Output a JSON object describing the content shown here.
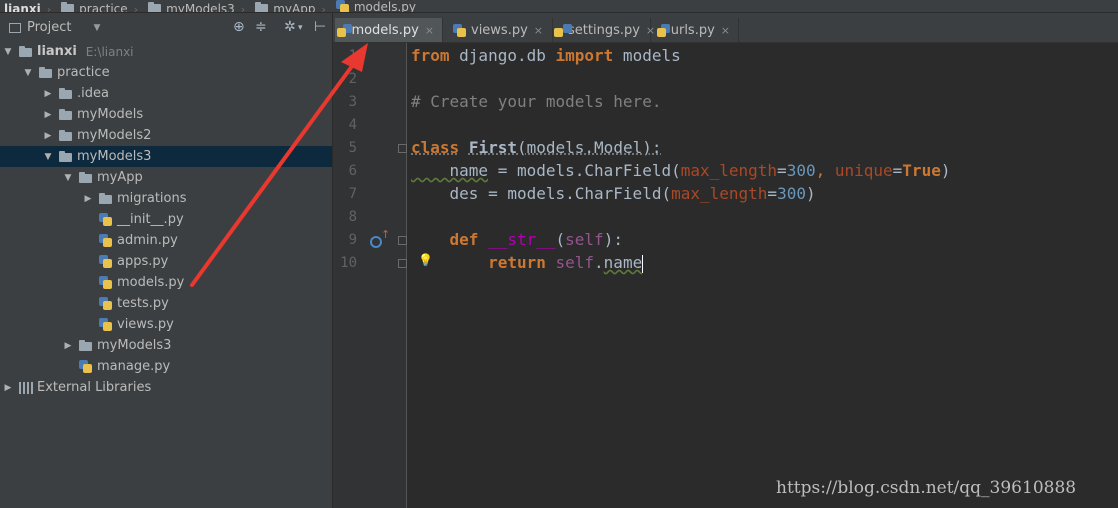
{
  "breadcrumb": [
    "lianxi",
    "practice",
    "myModels3",
    "myApp",
    "models.py"
  ],
  "project_panel": {
    "title": "Project",
    "icons": [
      "globe-icon",
      "collapse-icon",
      "gear-icon",
      "hide-panel-icon"
    ]
  },
  "tree": [
    {
      "label": "lianxi",
      "path": "E:\\lianxi",
      "level": 0,
      "type": "root-folder",
      "expanded": true
    },
    {
      "label": "practice",
      "level": 1,
      "type": "folder",
      "expanded": true
    },
    {
      "label": ".idea",
      "level": 2,
      "type": "folder",
      "expanded": false
    },
    {
      "label": "myModels",
      "level": 2,
      "type": "folder",
      "expanded": false
    },
    {
      "label": "myModels2",
      "level": 2,
      "type": "folder",
      "expanded": false
    },
    {
      "label": "myModels3",
      "level": 2,
      "type": "folder",
      "expanded": true,
      "selected": true
    },
    {
      "label": "myApp",
      "level": 3,
      "type": "folder",
      "expanded": true
    },
    {
      "label": "migrations",
      "level": 4,
      "type": "folder",
      "expanded": false
    },
    {
      "label": "__init__.py",
      "level": 4,
      "type": "python-file"
    },
    {
      "label": "admin.py",
      "level": 4,
      "type": "python-file"
    },
    {
      "label": "apps.py",
      "level": 4,
      "type": "python-file"
    },
    {
      "label": "models.py",
      "level": 4,
      "type": "python-file"
    },
    {
      "label": "tests.py",
      "level": 4,
      "type": "python-file"
    },
    {
      "label": "views.py",
      "level": 4,
      "type": "python-file"
    },
    {
      "label": "myModels3",
      "level": 3,
      "type": "folder",
      "expanded": false
    },
    {
      "label": "manage.py",
      "level": 3,
      "type": "python-file"
    },
    {
      "label": "External Libraries",
      "level": 0,
      "type": "libraries",
      "expanded": false
    }
  ],
  "tabs": [
    {
      "label": "models.py",
      "active": true,
      "close": "×"
    },
    {
      "label": "views.py",
      "active": false,
      "close": "×"
    },
    {
      "label": "settings.py",
      "active": false,
      "close": "×"
    },
    {
      "label": "urls.py",
      "active": false,
      "close": "×"
    }
  ],
  "editor": {
    "line_numbers": [
      "1",
      "2",
      "3",
      "4",
      "5",
      "6",
      "7",
      "8",
      "9",
      "10"
    ],
    "lines": [
      [
        {
          "t": "from",
          "c": "kw"
        },
        {
          "t": " django.db ",
          "c": ""
        },
        {
          "t": "import",
          "c": "kw"
        },
        {
          "t": " models",
          "c": ""
        }
      ],
      [],
      [
        {
          "t": "# Create your models here.",
          "c": "cm"
        }
      ],
      [],
      [
        {
          "t": "class",
          "c": "kw cls-underline"
        },
        {
          "t": " ",
          "c": ""
        },
        {
          "t": "First",
          "c": "cls-underline bold"
        },
        {
          "t": "(models.Model):",
          "c": "cls-underline"
        }
      ],
      [
        {
          "t": "    name",
          "c": "wavy"
        },
        {
          "t": " = models.CharField(",
          "c": ""
        },
        {
          "t": "max_length",
          "c": "param"
        },
        {
          "t": "=",
          "c": ""
        },
        {
          "t": "300",
          "c": "num"
        },
        {
          "t": ", ",
          "c": "kw2"
        },
        {
          "t": "unique",
          "c": "param"
        },
        {
          "t": "=",
          "c": ""
        },
        {
          "t": "True",
          "c": "kw"
        },
        {
          "t": ")",
          "c": ""
        }
      ],
      [
        {
          "t": "    des = models.CharField(",
          "c": ""
        },
        {
          "t": "max_length",
          "c": "param"
        },
        {
          "t": "=",
          "c": ""
        },
        {
          "t": "300",
          "c": "num"
        },
        {
          "t": ")",
          "c": ""
        }
      ],
      [],
      [
        {
          "t": "    ",
          "c": ""
        },
        {
          "t": "def",
          "c": "kw"
        },
        {
          "t": " ",
          "c": ""
        },
        {
          "t": "__str__",
          "c": "dunder"
        },
        {
          "t": "(",
          "c": ""
        },
        {
          "t": "self",
          "c": "selfk"
        },
        {
          "t": "):",
          "c": ""
        }
      ],
      [
        {
          "t": "        ",
          "c": ""
        },
        {
          "t": "return",
          "c": "kw"
        },
        {
          "t": " ",
          "c": ""
        },
        {
          "t": "self",
          "c": "selfk"
        },
        {
          "t": ".",
          "c": ""
        },
        {
          "t": "name",
          "c": "wavy"
        }
      ]
    ]
  },
  "watermark": "https://blog.csdn.net/qq_39610888",
  "colors": {
    "annotation_arrow": "#e8382f",
    "selection": "#0d293e"
  }
}
